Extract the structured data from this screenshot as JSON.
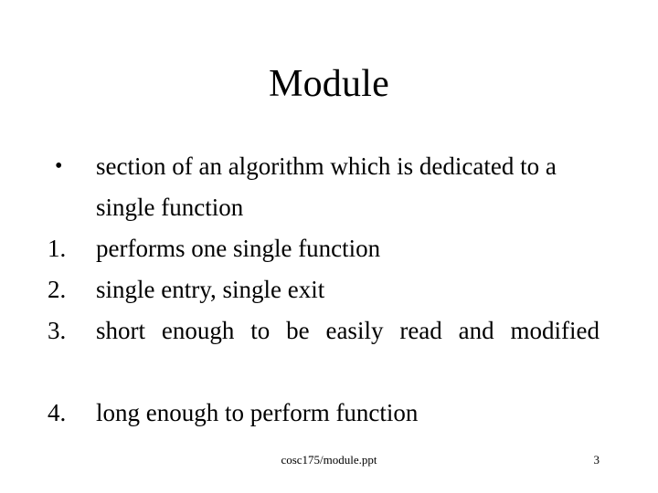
{
  "slide": {
    "title": "Module",
    "background_color": "#ffffff",
    "text_color": "#000000",
    "items": [
      {
        "marker": "•",
        "marker_type": "bullet",
        "text": "section of an algorithm which is dedicated to a single function",
        "align": "left"
      },
      {
        "marker": "1.",
        "marker_type": "number",
        "text": "performs one single function",
        "align": "left"
      },
      {
        "marker": "2.",
        "marker_type": "number",
        "text": "single entry, single exit",
        "align": "left"
      },
      {
        "marker": "3.",
        "marker_type": "number",
        "text": "short enough to be easily read and modified",
        "align": "justify"
      },
      {
        "marker": "4.",
        "marker_type": "number",
        "text": "long enough to perform function",
        "align": "left"
      }
    ],
    "footer": {
      "text": "cosc175/module.ppt",
      "page_number": "3"
    }
  }
}
